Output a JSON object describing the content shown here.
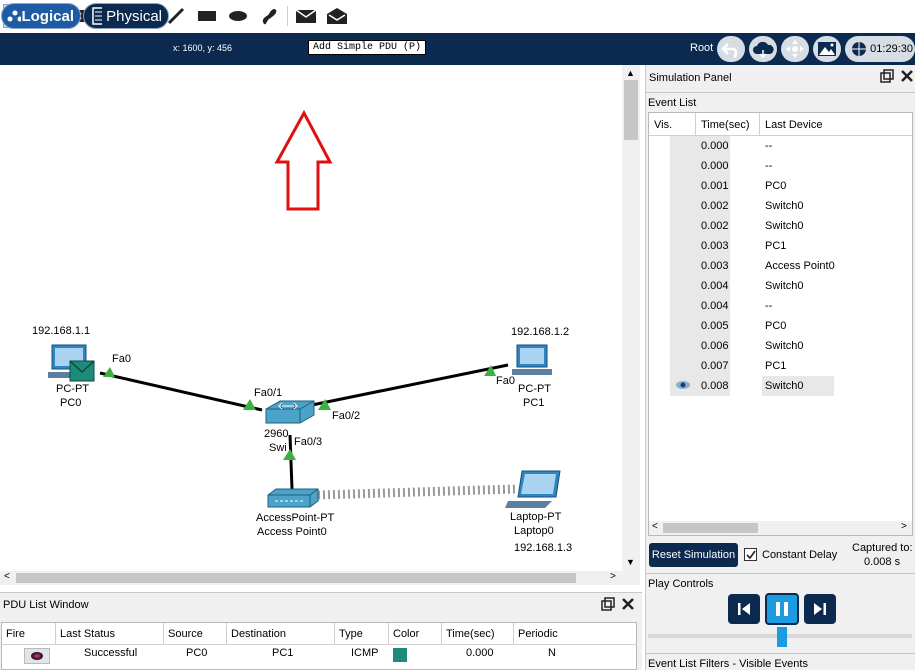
{
  "toolbar": {
    "tools": [
      "select-icon",
      "inspect-icon",
      "delete-icon",
      "resize-icon",
      "note-icon",
      "line-icon",
      "rectangle-icon",
      "ellipse-icon",
      "freeform-icon",
      "add-simple-pdu-icon",
      "add-complex-pdu-icon"
    ]
  },
  "tooltip": "Add Simple PDU (P)",
  "nav": {
    "logical": "Logical",
    "physical": "Physical",
    "coords": "x: 1600, y: 456",
    "root": "Root",
    "time": "01:29:30"
  },
  "topology": {
    "pc0": {
      "ip": "192.168.1.1",
      "model": "PC-PT",
      "name": "PC0",
      "port": "Fa0"
    },
    "pc1": {
      "ip": "192.168.1.2",
      "model": "PC-PT",
      "name": "PC1",
      "port": "Fa0"
    },
    "switch": {
      "model_partial": "2960",
      "name_partial": "Swi",
      "ports": [
        "Fa0/1",
        "Fa0/2",
        "Fa0/3"
      ]
    },
    "ap": {
      "model": "AccessPoint-PT",
      "name": "Access Point0"
    },
    "laptop": {
      "model": "Laptop-PT",
      "name": "Laptop0",
      "ip": "192.168.1.3"
    }
  },
  "sim_panel": {
    "title": "Simulation Panel",
    "event_list_title": "Event List",
    "columns": [
      "Vis.",
      "Time(sec)",
      "Last Device"
    ],
    "events": [
      {
        "time": "0.000",
        "device": "--"
      },
      {
        "time": "0.000",
        "device": "--"
      },
      {
        "time": "0.001",
        "device": "PC0"
      },
      {
        "time": "0.002",
        "device": "Switch0"
      },
      {
        "time": "0.002",
        "device": "Switch0"
      },
      {
        "time": "0.003",
        "device": "PC1"
      },
      {
        "time": "0.003",
        "device": "Access Point0"
      },
      {
        "time": "0.004",
        "device": "Switch0"
      },
      {
        "time": "0.004",
        "device": "--"
      },
      {
        "time": "0.005",
        "device": "PC0"
      },
      {
        "time": "0.006",
        "device": "Switch0"
      },
      {
        "time": "0.007",
        "device": "PC1"
      },
      {
        "time": "0.008",
        "device": "Switch0",
        "visible": true
      }
    ],
    "reset": "Reset Simulation",
    "constant_delay": "Constant Delay",
    "captured_label": "Captured to:",
    "captured_value": "0.008 s",
    "play_controls": "Play Controls",
    "filters": "Event List Filters - Visible Events"
  },
  "pdu_list": {
    "title": "PDU List Window",
    "columns": [
      "Fire",
      "Last Status",
      "Source",
      "Destination",
      "Type",
      "Color",
      "Time(sec)",
      "Periodic"
    ],
    "rows": [
      {
        "status": "Successful",
        "source": "PC0",
        "destination": "PC1",
        "type": "ICMP",
        "color": "#1e8a78",
        "time": "0.000",
        "periodic": "N"
      }
    ]
  },
  "colors": {
    "navbar": "#0c2a4f",
    "accent": "#1d5ca4",
    "link": "#000000",
    "arrow": "#e00000",
    "pdu_color": "#1e8a78"
  }
}
